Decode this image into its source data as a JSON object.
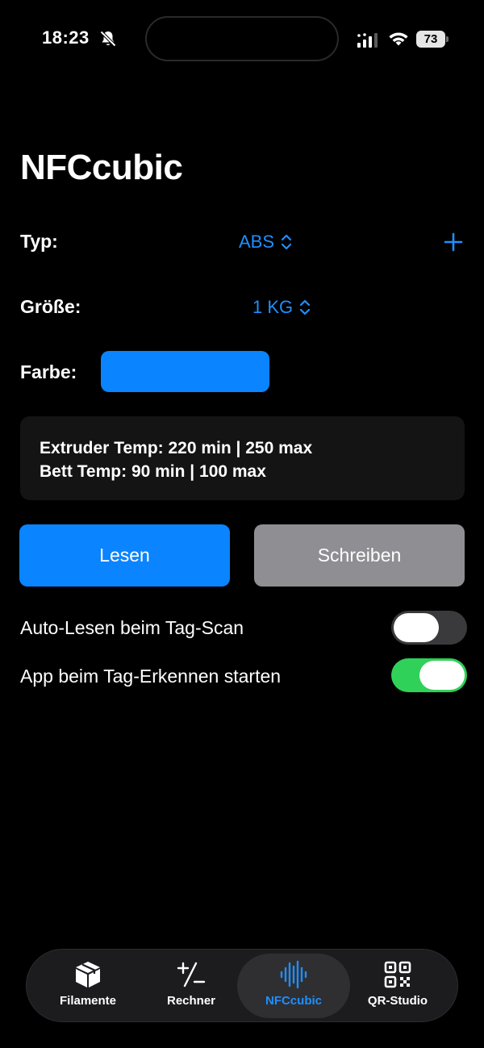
{
  "status_bar": {
    "time": "18:23",
    "battery": "73",
    "icons": [
      "bell-slash-icon",
      "signal-icon",
      "wifi-icon",
      "battery-icon"
    ]
  },
  "page": {
    "title": "NFCcubic"
  },
  "form": {
    "type_label": "Typ:",
    "type_value": "ABS",
    "size_label": "Größe:",
    "size_value": "1 KG",
    "color_label": "Farbe:",
    "color_value": "#0a84ff"
  },
  "info": {
    "line1": "Extruder Temp: 220 min | 250 max",
    "line2": "Bett Temp: 90 min | 100 max"
  },
  "buttons": {
    "read": "Lesen",
    "write": "Schreiben"
  },
  "toggles": [
    {
      "label": "Auto-Lesen beim Tag-Scan",
      "on": false
    },
    {
      "label": "App beim Tag-Erkennen starten",
      "on": true
    }
  ],
  "tabs": [
    {
      "label": "Filamente",
      "icon": "box-icon",
      "active": false
    },
    {
      "label": "Rechner",
      "icon": "plus-minus-icon",
      "active": false
    },
    {
      "label": "NFCcubic",
      "icon": "waveform-icon",
      "active": true
    },
    {
      "label": "QR-Studio",
      "icon": "qrcode-icon",
      "active": false
    }
  ],
  "colors": {
    "accent": "#0a84ff",
    "toggle_on": "#30d158",
    "secondary_button": "#8e8e93"
  }
}
